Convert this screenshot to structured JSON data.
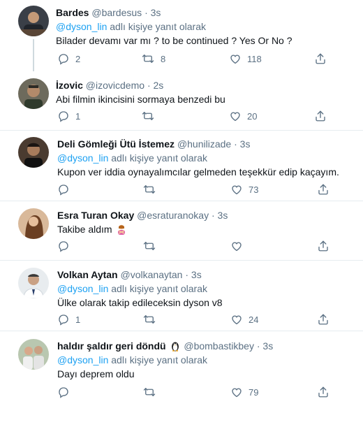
{
  "reply_prefix": "adlı kişiye yanıt olarak",
  "tweets": [
    {
      "name": "Bardes",
      "handle": "@bardesus",
      "time": "3s",
      "reply_to": "@dyson_lin",
      "text": "Bilader devamı var mı ? to be continued ? Yes Or No ?",
      "replies": "2",
      "retweets": "8",
      "likes": "118"
    },
    {
      "name": "İzovic",
      "handle": "@izovicdemo",
      "time": "2s",
      "text": "Abi filmin ikincisini sormaya benzedi bu",
      "replies": "1",
      "retweets": "",
      "likes": "20"
    },
    {
      "name": "Deli Gömleği Ütü İstemez",
      "handle": "@hunilizade",
      "time": "3s",
      "reply_to": "@dyson_lin",
      "text": "Kupon ver iddia oynayalımcılar gelmeden teşekkür edip kaçayım.",
      "replies": "",
      "retweets": "",
      "likes": "73"
    },
    {
      "name": "Esra Turan Okay",
      "handle": "@esraturanokay",
      "time": "3s",
      "text": "Takibe aldım",
      "emoji": "person-gesturing-no-emoji",
      "replies": "",
      "retweets": "",
      "likes": ""
    },
    {
      "name": "Volkan Aytan",
      "handle": "@volkanaytan",
      "time": "3s",
      "reply_to": "@dyson_lin",
      "text": "Ülke olarak takip edileceksin dyson v8",
      "replies": "1",
      "retweets": "",
      "likes": "24"
    },
    {
      "name": "haldır şaldır geri döndü",
      "name_icon": "penguin-emoji",
      "handle": "@bombastikbey",
      "time": "3s",
      "reply_to": "@dyson_lin",
      "text": "Dayı deprem oldu",
      "replies": "",
      "retweets": "",
      "likes": "79"
    }
  ],
  "colors": {
    "link": "#1da1f2",
    "muted": "#5b7083",
    "text": "#0f1419",
    "separator": "#e6ecf0"
  },
  "icons": [
    "reply-icon",
    "retweet-icon",
    "like-icon",
    "share-icon"
  ]
}
